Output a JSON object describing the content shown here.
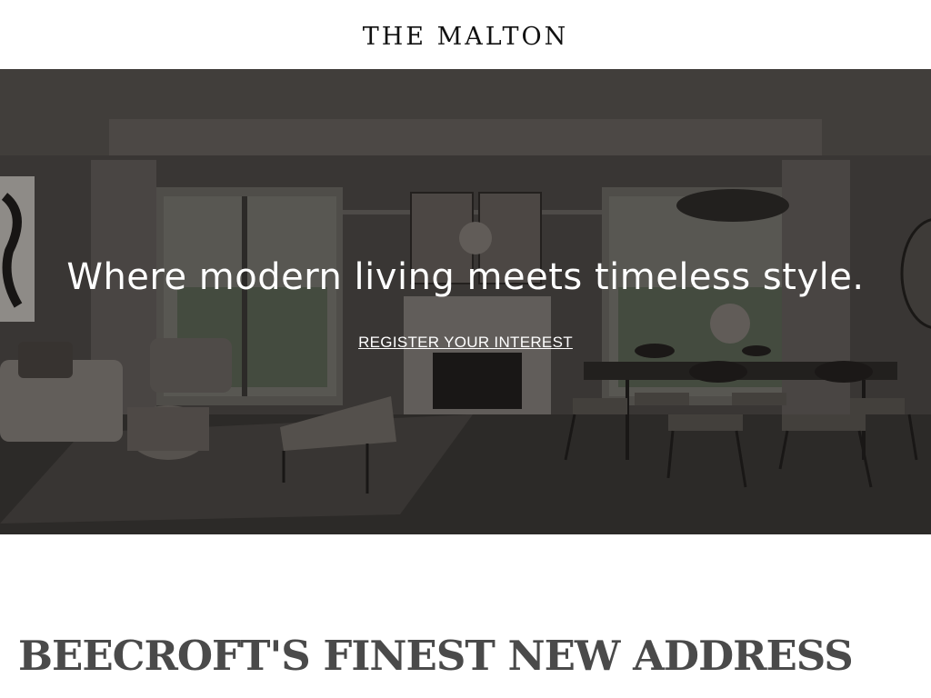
{
  "header": {
    "logo_text": "THE MALTON"
  },
  "hero": {
    "headline": "Where modern living meets timeless style.",
    "cta_label": "REGISTER YOUR INTEREST"
  },
  "section": {
    "title": "BEECROFT'S FINEST NEW ADDRESS"
  },
  "colors": {
    "background": "#ffffff",
    "logo": "#111111",
    "hero_text": "#ffffff",
    "section_title": "#4a4a4a"
  }
}
